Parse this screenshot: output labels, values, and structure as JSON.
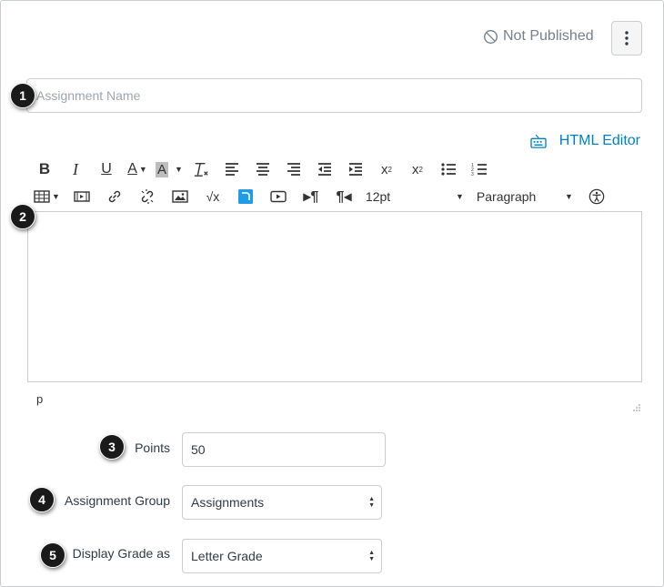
{
  "header": {
    "status_label": "Not Published"
  },
  "assignment_name": {
    "value": "",
    "placeholder": "Assignment Name"
  },
  "editor": {
    "html_editor_label": "HTML Editor",
    "font_size": "12pt",
    "block_format": "Paragraph",
    "path": "p"
  },
  "points": {
    "label": "Points",
    "value": "50"
  },
  "assignment_group": {
    "label": "Assignment Group",
    "value": "Assignments"
  },
  "display_grade": {
    "label": "Display Grade as",
    "value": "Letter Grade"
  },
  "callouts": [
    "1",
    "2",
    "3",
    "4",
    "5"
  ],
  "colors": {
    "link": "#0081c7",
    "muted": "#73818c",
    "border": "#c7cdd1",
    "callout": "#1a1a1a"
  }
}
